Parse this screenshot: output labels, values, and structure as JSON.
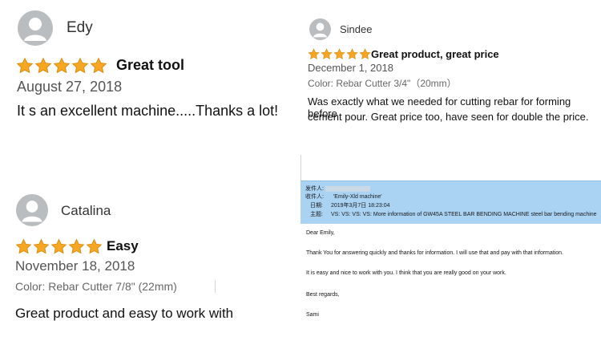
{
  "reviews": [
    {
      "name": "Edy",
      "rating": 5,
      "headline": "Great tool",
      "date": "August 27, 2018",
      "variant": "",
      "text": "It s an excellent machine.....Thanks a lot!"
    },
    {
      "name": "Sindee",
      "rating": 5,
      "headline": "Great product, great price",
      "date": "December 1, 2018",
      "variant": "Color: Rebar Cutter 3/4\"（20mm）",
      "text_line1": "Was exactly what we needed for cutting rebar for forming before",
      "text_line2": "cement pour. Great price too, have seen for double the price."
    },
    {
      "name": "Catalina",
      "rating": 5,
      "headline": "Easy",
      "date": "November 18, 2018",
      "variant": "Color: Rebar Cutter 7/8\" (22mm)",
      "text": "Great product and easy to work with"
    }
  ],
  "email": {
    "from_label": "发件人:",
    "from_value": "",
    "to_label": "收件人:",
    "to_value": "'Emily-Xld machine'",
    "date_label": "日期:",
    "date_value": "2019年3月7日 18:23:04",
    "subject_label": "主题:",
    "subject_value": "VS: VS: VS: VS: More information of GW45A STEEL BAR BENDING MACHINE steel bar bending machine",
    "greeting": "Dear Emily,",
    "paragraph1": "Thank You for answering quickly and thanks for information. I will use that and pay with that information.",
    "paragraph2": "It is easy and nice to work with you. I think that you are really good on your work.",
    "closing": "Best regards,",
    "signature": "Sami"
  },
  "colors": {
    "star": "#f5a623",
    "star_stroke": "#d98b0a",
    "email_header": "#a9d2f3",
    "avatar": "#b9bdbf"
  }
}
